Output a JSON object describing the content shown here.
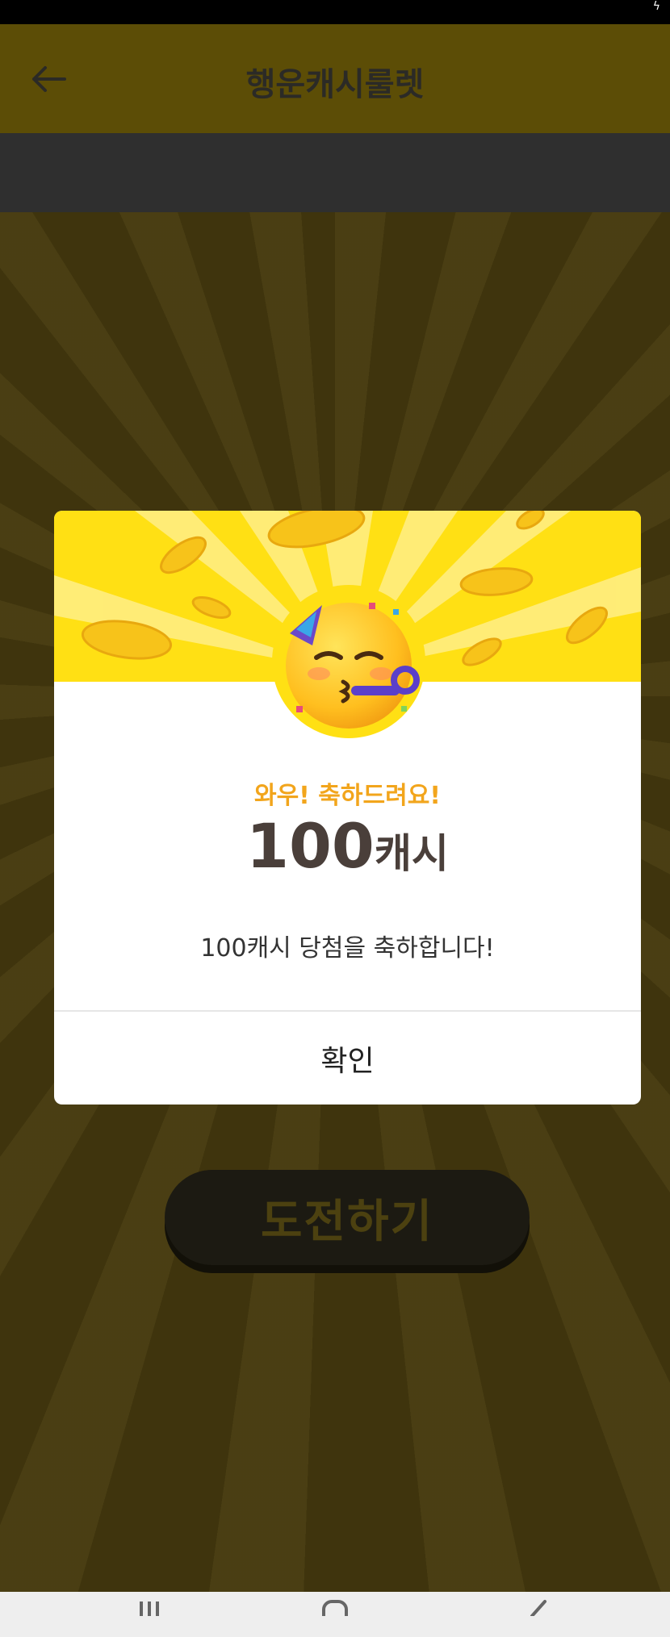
{
  "status_bar": {
    "icon": "charging-bolt-icon"
  },
  "header": {
    "back_icon": "arrow-left-icon",
    "title": "행운캐시룰렛"
  },
  "main": {
    "challenge_button": "도전하기"
  },
  "modal": {
    "hero_icon": "party-face-emoji-icon",
    "headline": "와우! 축하드려요!",
    "prize_amount": "100",
    "prize_unit": "캐시",
    "message": "100캐시 당첨을 축하합니다!",
    "confirm_label": "확인"
  },
  "nav_bar": {
    "items": [
      "recent-apps-icon",
      "home-icon",
      "back-icon"
    ]
  },
  "colors": {
    "accent_yellow": "#ffe014",
    "headline_orange": "#f2a51c",
    "prize_text": "#4a3f3a"
  }
}
